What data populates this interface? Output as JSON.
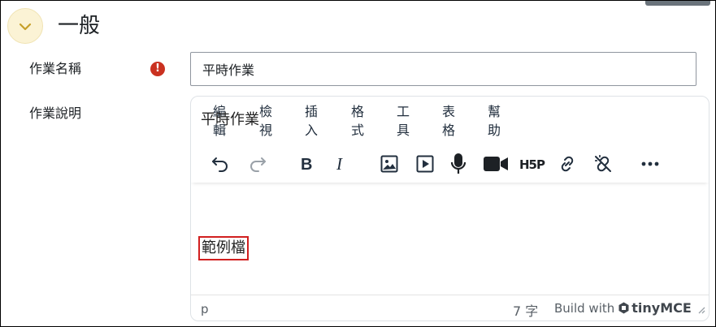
{
  "section": {
    "title": "一般"
  },
  "fields": {
    "name": {
      "label": "作業名稱",
      "value": "平時作業",
      "required_icon": "exclamation-circle-icon"
    },
    "description": {
      "label": "作業說明"
    }
  },
  "editor": {
    "menu": [
      {
        "label": "編輯"
      },
      {
        "label": "檢視"
      },
      {
        "label": "插入"
      },
      {
        "label": "格式"
      },
      {
        "label": "工具"
      },
      {
        "label": "表格"
      },
      {
        "label": "幫助"
      }
    ],
    "toolbar": [
      {
        "icon": "undo-icon"
      },
      {
        "icon": "redo-icon"
      },
      {
        "icon": "bold-icon"
      },
      {
        "icon": "italic-icon"
      },
      {
        "icon": "image-icon"
      },
      {
        "icon": "media-icon"
      },
      {
        "icon": "microphone-icon"
      },
      {
        "icon": "video-camera-icon"
      },
      {
        "icon": "h5p-icon",
        "text": "H5P"
      },
      {
        "icon": "link-icon"
      },
      {
        "icon": "unlink-icon"
      },
      {
        "icon": "more-icon"
      }
    ],
    "content": {
      "line1": "平時作業",
      "line2": "範例檔"
    },
    "status": {
      "path": "p",
      "word_count": "7 字",
      "build_with": "Build with",
      "brand": "tinyMCE"
    }
  },
  "colors": {
    "required": "#ca3120",
    "collapse_bg": "#fbf3d5",
    "highlight_box": "#d11f1f"
  }
}
